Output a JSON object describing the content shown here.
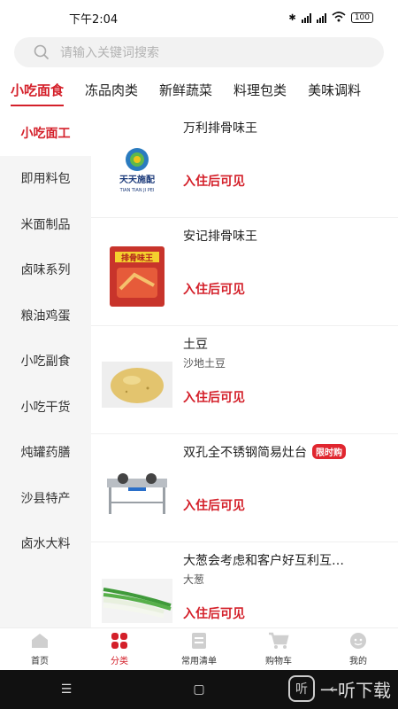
{
  "status": {
    "time": "下午2:04",
    "battery": "100"
  },
  "search": {
    "placeholder": "请输入关键词搜索"
  },
  "categories": [
    "小吃面食",
    "冻品肉类",
    "新鲜蔬菜",
    "料理包类",
    "美味调料"
  ],
  "sidebar": [
    "小吃面工",
    "即用料包",
    "米面制品",
    "卤味系列",
    "粮油鸡蛋",
    "小吃副食",
    "小吃干货",
    "炖罐药膳",
    "沙县特产",
    "卤水大料"
  ],
  "products": [
    {
      "name": "万利排骨味王",
      "subtitle": "",
      "price_text": "入住后可见",
      "badge": "",
      "thumb_text": "天天施配",
      "thumb_sub": "TIAN TIAN JI PEI"
    },
    {
      "name": "安记排骨味王",
      "subtitle": "",
      "price_text": "入住后可见",
      "badge": "",
      "thumb_text": "排骨味王"
    },
    {
      "name": "土豆",
      "subtitle": "沙地土豆",
      "price_text": "入住后可见",
      "badge": ""
    },
    {
      "name": "双孔全不锈钢简易灶台",
      "subtitle": "",
      "price_text": "入住后可见",
      "badge": "限时购"
    },
    {
      "name": "大葱会考虑和客户好互利互…",
      "subtitle": "大葱",
      "price_text": "入住后可见",
      "badge": ""
    }
  ],
  "bottom_nav": [
    "首页",
    "分类",
    "常用清单",
    "购物车",
    "我的"
  ],
  "watermark": "一听下载",
  "colors": {
    "accent": "#d4202a"
  }
}
